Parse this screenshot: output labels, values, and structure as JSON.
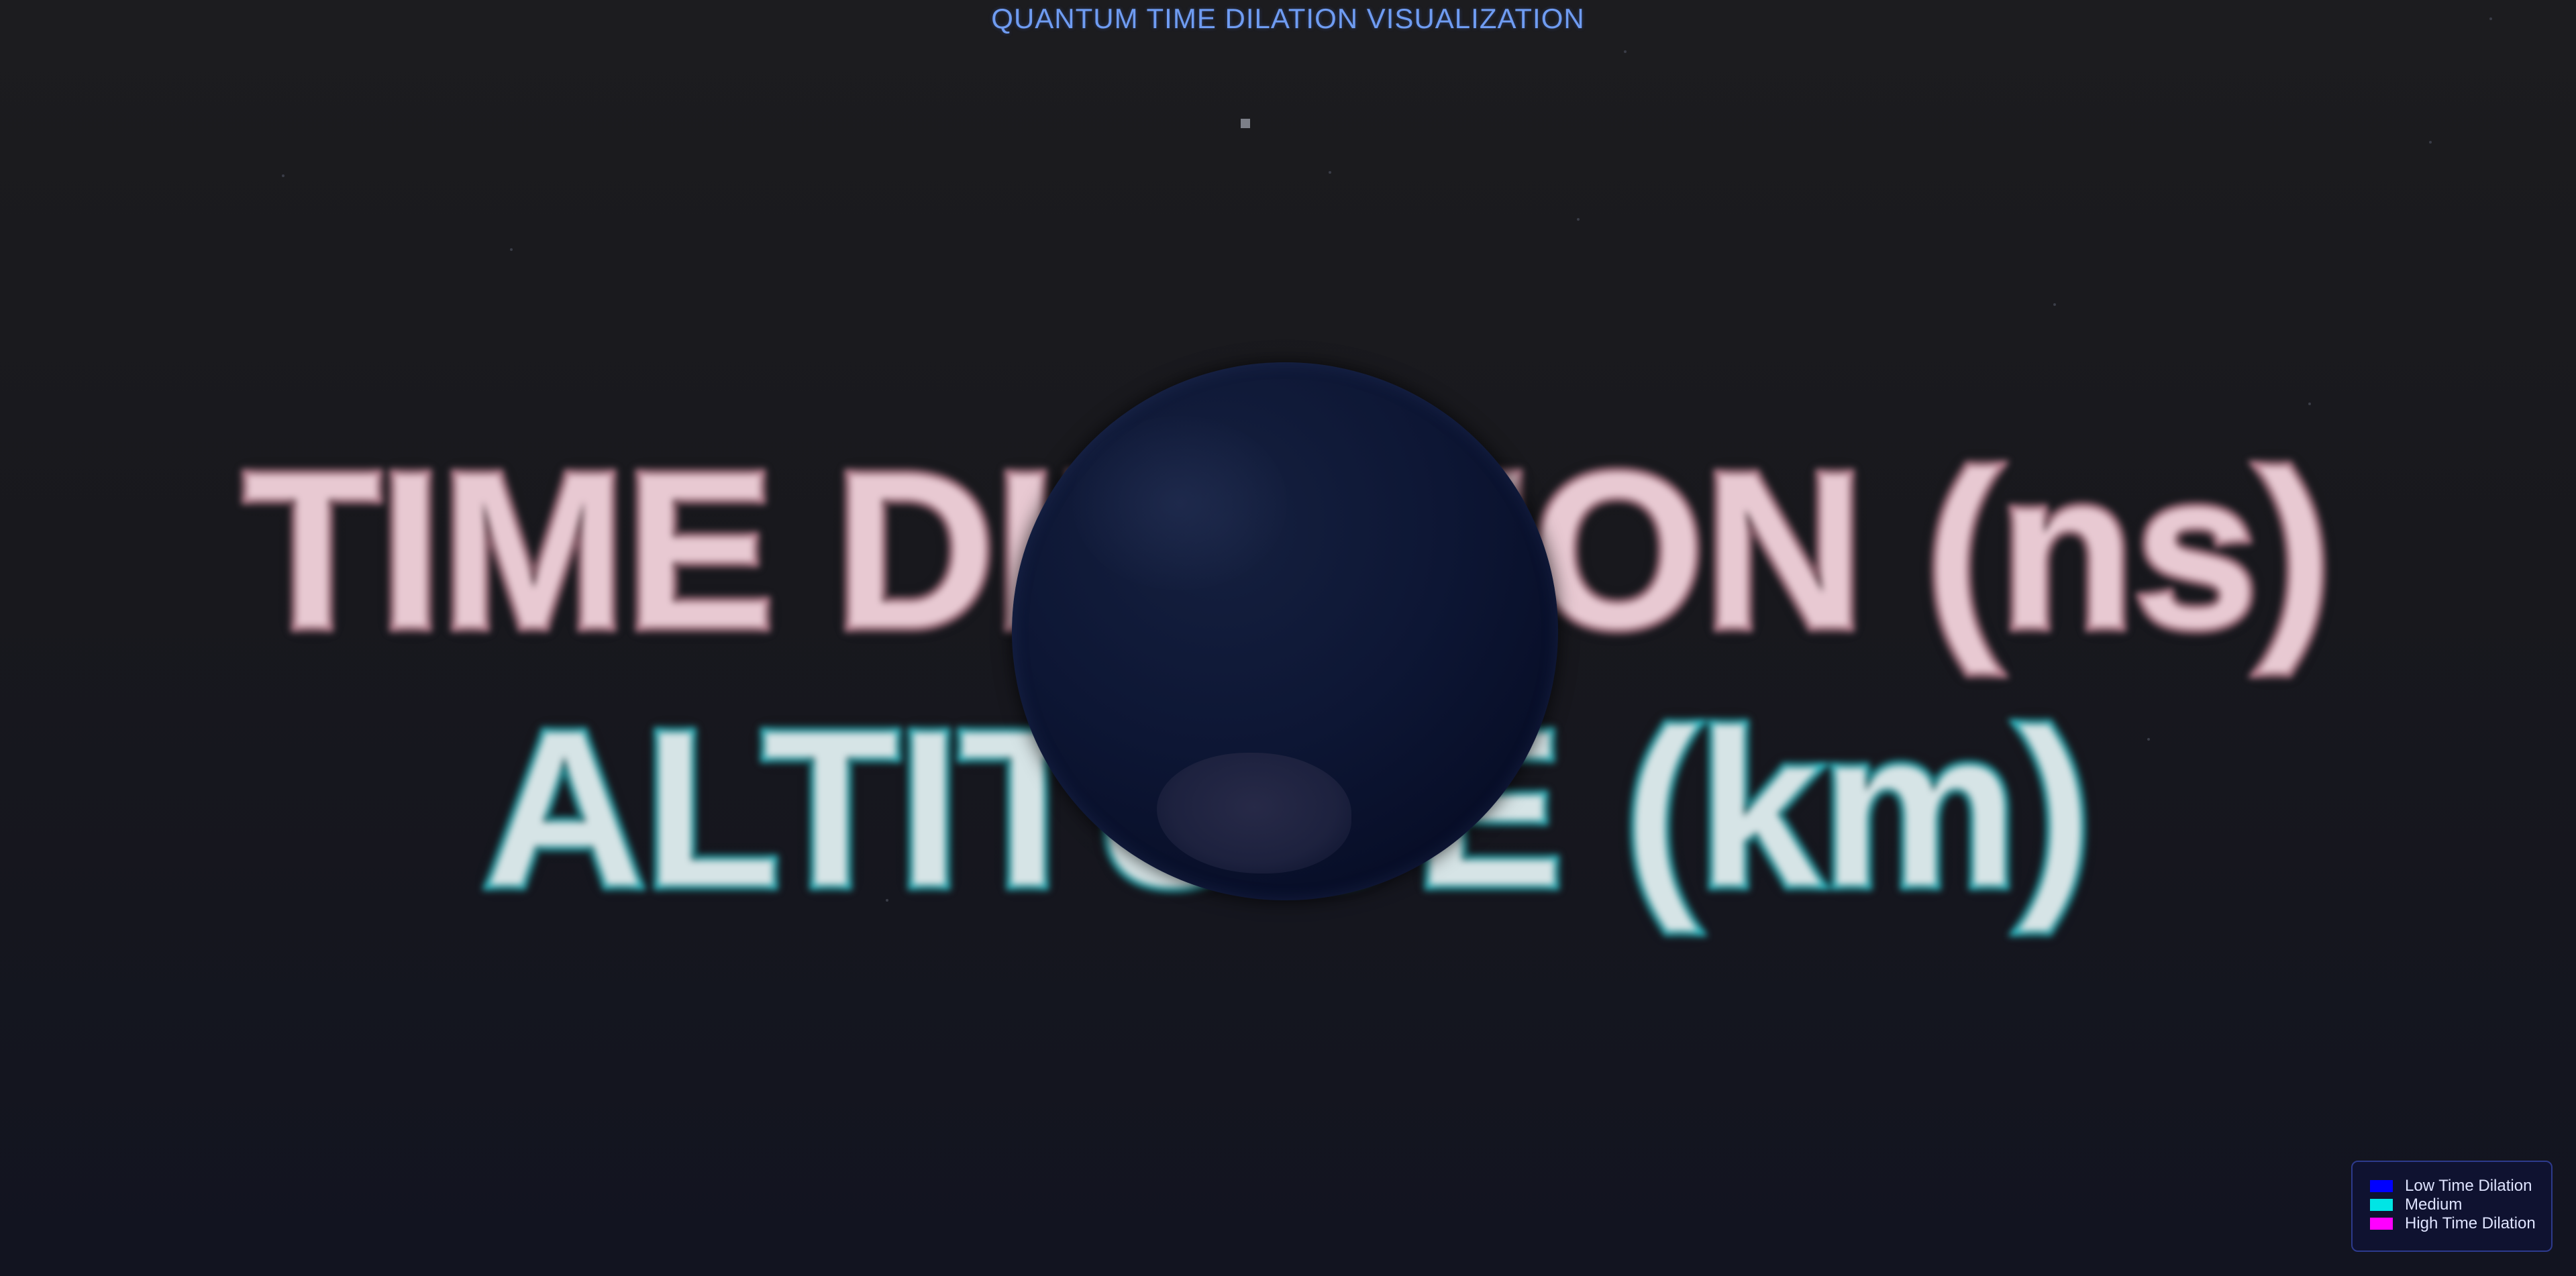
{
  "header": {
    "title": "QUANTUM TIME DILATION VISUALIZATION"
  },
  "labels": {
    "time_dilation": "TIME DILATION (ns)",
    "altitude": "ALTITUDE (km)"
  },
  "legend": {
    "items": [
      {
        "label": "Low Time Dilation",
        "color": "#0000ff"
      },
      {
        "label": "Medium",
        "color": "#00e5e5"
      },
      {
        "label": "High Time Dilation",
        "color": "#ff00ff"
      }
    ]
  },
  "colors": {
    "title": "#6f9cf2",
    "background": "#1a1a1e",
    "globe": "#0a1230"
  },
  "icons": {
    "globe": "earth-globe-icon"
  }
}
